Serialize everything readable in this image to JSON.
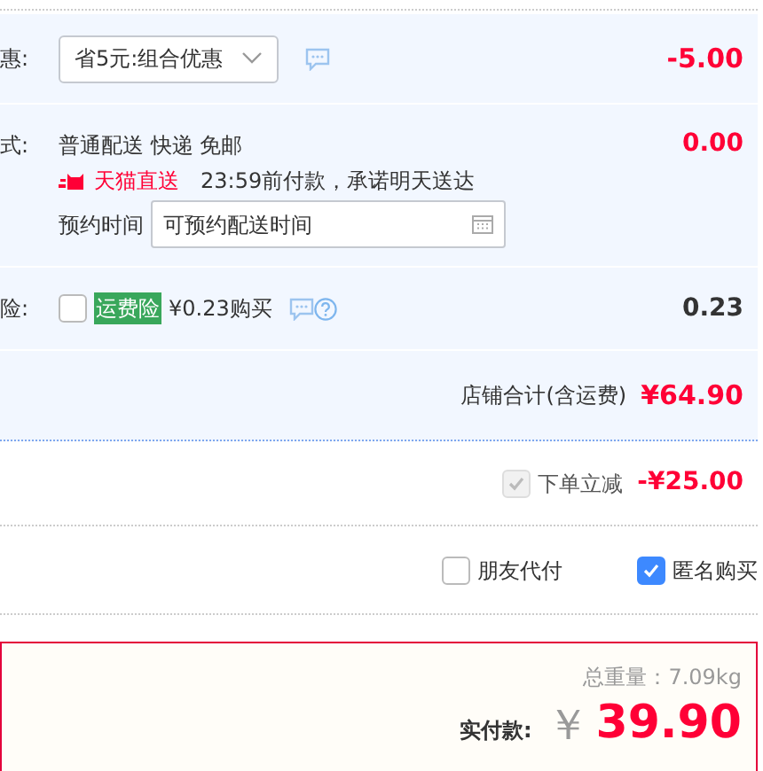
{
  "discount_row": {
    "label": "惠:",
    "select": "省5元:组合优惠",
    "amount": "-5.00"
  },
  "delivery_row": {
    "label": "式:",
    "method": "普通配送 快递 免邮",
    "badge": "天猫直送",
    "promise": "23:59前付款，承诺明天送达",
    "schedule_label": "预约时间",
    "schedule_placeholder": "可预约配送时间",
    "amount": "0.00"
  },
  "insurance_row": {
    "label": "险:",
    "checked": false,
    "tag": "运费险",
    "price": "¥0.23购买",
    "amount": "0.23"
  },
  "store_total": {
    "label": "店铺合计(含运费)",
    "amount": "¥64.90"
  },
  "instant_discount": {
    "checked": true,
    "disabled": true,
    "label": "下单立减",
    "amount": "-¥25.00"
  },
  "options": [
    {
      "label": "朋友代付",
      "checked": false
    },
    {
      "label": "匿名购买",
      "checked": true
    }
  ],
  "summary": {
    "weight": "总重量：7.09kg",
    "pay_label": "实付款:",
    "currency": "￥",
    "total": "39.90"
  }
}
